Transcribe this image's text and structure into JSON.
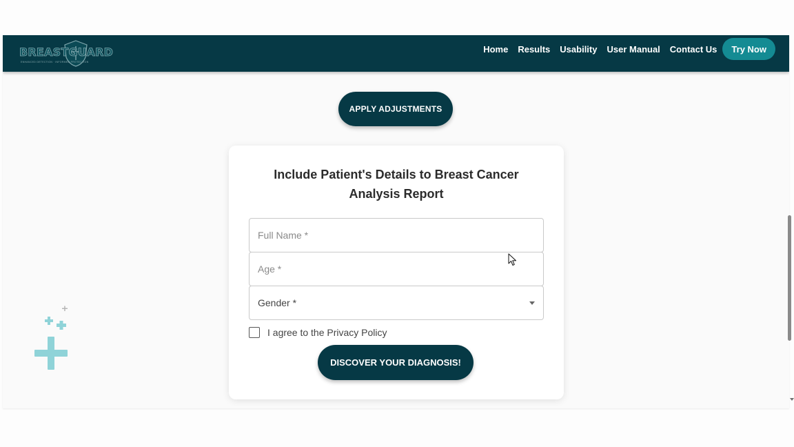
{
  "brand": {
    "name": "BREASTGUARD",
    "tagline": "ENHANCED DETECTION · INFORMED PROTECTION"
  },
  "nav": {
    "items": [
      "Home",
      "Results",
      "Usability",
      "User Manual",
      "Contact Us"
    ],
    "cta": "Try Now"
  },
  "actions": {
    "apply_label": "APPLY ADJUSTMENTS"
  },
  "form": {
    "title_line1": "Include Patient's Details to Breast Cancer",
    "title_line2": "Analysis Report",
    "full_name_placeholder": "Full Name *",
    "age_placeholder": "Age *",
    "gender_placeholder": "Gender *",
    "agree_label": "I agree to the Privacy Policy",
    "submit_label": "DISCOVER YOUR DIAGNOSIS!"
  },
  "colors": {
    "primary": "#063945",
    "accent": "#148b93",
    "decoration": "#8fd3d8"
  },
  "icons": {
    "select_caret": "chevron-down-icon",
    "decoration": "plus-icon",
    "cursor": "mouse-pointer-icon"
  }
}
